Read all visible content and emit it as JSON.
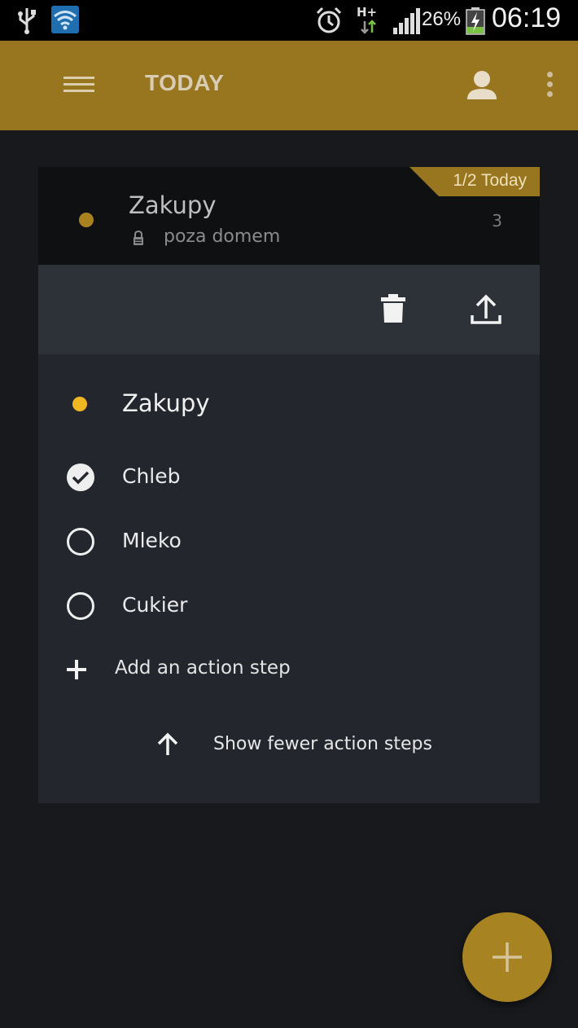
{
  "status_bar": {
    "network_type": "H+",
    "battery_percent": "26%",
    "time": "06:19"
  },
  "app_bar": {
    "title": "TODAY"
  },
  "task_card": {
    "ribbon": "1/2 Today",
    "title": "Zakupy",
    "context": "poza domem",
    "count": "3",
    "dot_color": "#a9821f"
  },
  "expanded": {
    "title": "Zakupy",
    "dot_color": "#f3b623",
    "steps": [
      {
        "label": "Chleb",
        "done": true
      },
      {
        "label": "Mleko",
        "done": false
      },
      {
        "label": "Cukier",
        "done": false
      }
    ],
    "add_step_label": "Add an action step",
    "show_fewer_label": "Show fewer action steps"
  },
  "colors": {
    "accent": "#98751f",
    "fab": "#a88322"
  }
}
